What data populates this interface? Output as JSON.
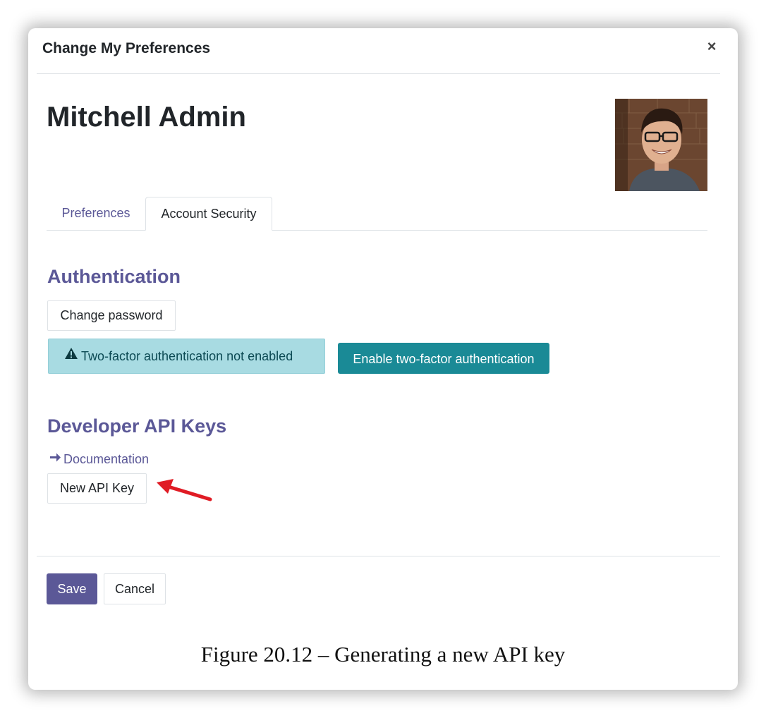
{
  "dialog": {
    "title": "Change My Preferences",
    "close_symbol": "×"
  },
  "user": {
    "name": "Mitchell Admin"
  },
  "tabs": [
    {
      "label": "Preferences",
      "active": false
    },
    {
      "label": "Account Security",
      "active": true
    }
  ],
  "authentication": {
    "title": "Authentication",
    "change_password_label": "Change password",
    "two_factor_status": "Two-factor authentication not enabled",
    "enable_two_factor_label": "Enable two-factor authentication"
  },
  "developer_api_keys": {
    "title": "Developer API Keys",
    "documentation_label": "Documentation",
    "new_api_key_label": "New API Key"
  },
  "footer": {
    "save_label": "Save",
    "cancel_label": "Cancel"
  },
  "caption": "Figure 20.12 – Generating a new API key",
  "icons": {
    "close": "close-icon",
    "warning": "warning-icon",
    "arrow": "arrow-right-icon",
    "annotation": "red-arrow-icon"
  },
  "colors": {
    "accent": "#5b5897",
    "teal_button": "#1a8a96",
    "alert_bg": "#a8dbe2",
    "annotation_red": "#e01b24"
  }
}
